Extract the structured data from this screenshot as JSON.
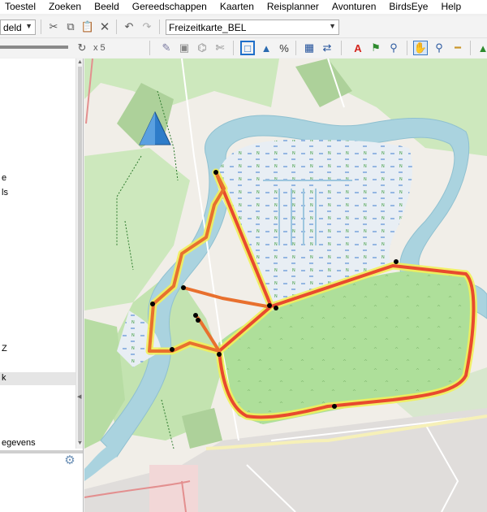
{
  "menu": [
    "Toestel",
    "Zoeken",
    "Beeld",
    "Gereedschappen",
    "Kaarten",
    "Reisplanner",
    "Avonturen",
    "BirdsEye",
    "Help"
  ],
  "toolbar": {
    "view_combo": "deld",
    "map_combo": "Freizeitkarte_BEL",
    "zoom_multiplier": "x 5"
  },
  "tree_items": [
    {
      "label": "e",
      "selected": false
    },
    {
      "label": "ls",
      "selected": false
    },
    {
      "label": "Z",
      "selected": false
    },
    {
      "label": "k",
      "selected": true
    },
    {
      "label": "egevens",
      "selected": false
    }
  ],
  "icons": {
    "cut": "scissors-icon",
    "copy": "copy-icon",
    "paste": "paste-icon",
    "delete": "delete-icon",
    "undo": "undo-icon",
    "redo": "redo-icon",
    "settings": "gear-icon",
    "waypoint": "waypoint-icon",
    "hand": "hand-pan-icon",
    "search": "magnifier-icon",
    "measure": "ruler-icon"
  },
  "colors": {
    "route_red": "#e84a2e",
    "route_yellow": "#f2f05a",
    "water": "#aad3df",
    "park": "#c8e6b0",
    "wetland": "#e6eef5"
  }
}
